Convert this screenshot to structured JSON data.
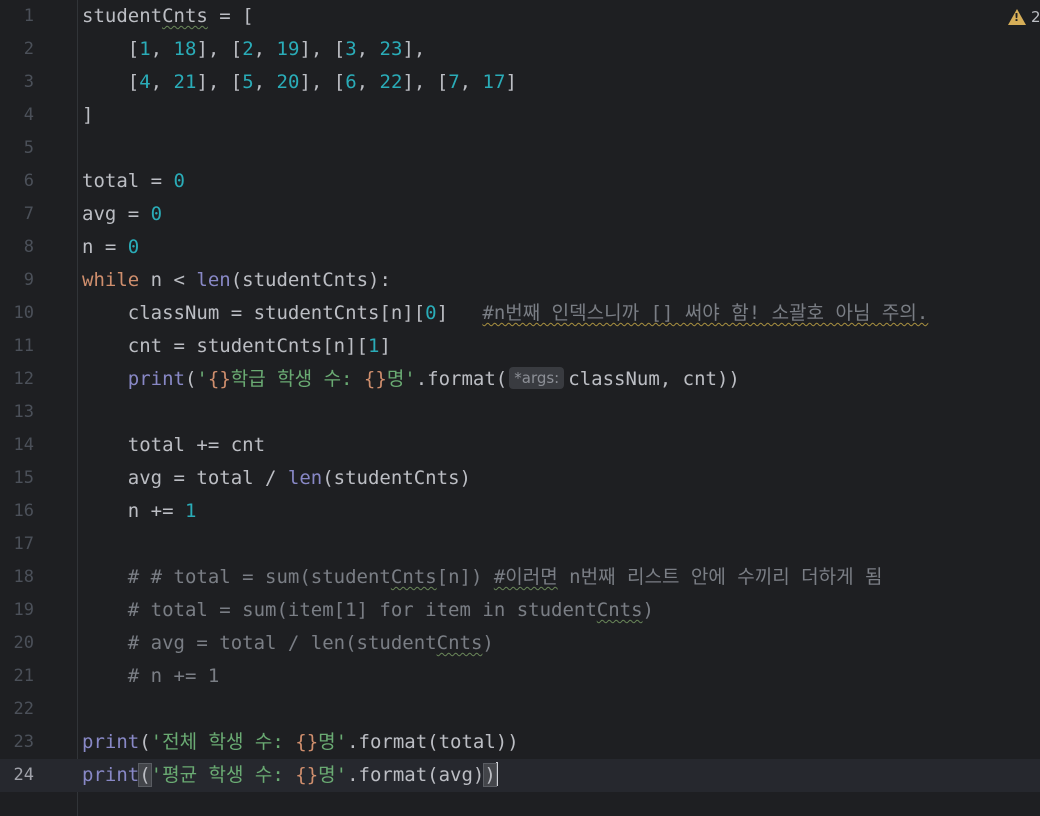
{
  "warnings": {
    "count": "2"
  },
  "hint": {
    "args": "*args:"
  },
  "lines": [
    "1",
    "2",
    "3",
    "4",
    "5",
    "6",
    "7",
    "8",
    "9",
    "10",
    "11",
    "12",
    "13",
    "14",
    "15",
    "16",
    "17",
    "18",
    "19",
    "20",
    "21",
    "22",
    "23",
    "24"
  ],
  "code": {
    "l1_a": "student",
    "l1_b": "Cnts",
    "l1_c": " = [",
    "l2": "    [1, 18], [2, 19], [3, 23],",
    "l3": "    [4, 21], [5, 20], [6, 22], [7, 17]",
    "l4": "]",
    "l6_a": "total = ",
    "l6_b": "0",
    "l7_a": "avg = ",
    "l7_b": "0",
    "l8_a": "n = ",
    "l8_b": "0",
    "l9_kw": "while",
    "l9_a": " n < ",
    "l9_fn": "len",
    "l9_b": "(studentCnts):",
    "l10_a": "    classNum = studentCnts[n][",
    "l10_num": "0",
    "l10_b": "]   ",
    "l10_cmt": "#n번째 인덱스니까 [] 써야 함! 소괄호 아님 주의.",
    "l11_a": "    cnt = studentCnts[n][",
    "l11_num": "1",
    "l11_b": "]",
    "l12_ind": "    ",
    "l12_fn": "print",
    "l12_a": "(",
    "l12_str1": "'",
    "l12_esc1": "{}",
    "l12_str2": "학급 학생 수: ",
    "l12_esc2": "{}",
    "l12_str3": "명'",
    "l12_b": ".format(",
    "l12_c": "classNum, cnt))",
    "l14": "    total += cnt",
    "l15_a": "    avg = total / ",
    "l15_fn": "len",
    "l15_b": "(studentCnts)",
    "l16_a": "    n += ",
    "l16_num": "1",
    "l18_ind": "    ",
    "l18_a": "# # total = sum(student",
    "l18_b": "Cnts",
    "l18_c": "[n]) ",
    "l18_d": "#이러면",
    "l18_e": " n번째 리스트 안에 수끼리 더하게 됨",
    "l19_ind": "    ",
    "l19_a": "# total = sum(item[1] for item in student",
    "l19_b": "Cnts",
    "l19_c": ")",
    "l20_ind": "    ",
    "l20_a": "# avg = total / len(student",
    "l20_b": "Cnts",
    "l20_c": ")",
    "l21": "    # n += 1",
    "l23_fn": "print",
    "l23_a": "(",
    "l23_str1": "'전체 학생 수: ",
    "l23_esc": "{}",
    "l23_str2": "명'",
    "l23_b": ".format(total))",
    "l24_fn": "print",
    "l24_a": "(",
    "l24_str1": "'평균 학생 수: ",
    "l24_esc": "{}",
    "l24_str2": "명'",
    "l24_b": ".format(avg)",
    "l24_c": ")"
  }
}
